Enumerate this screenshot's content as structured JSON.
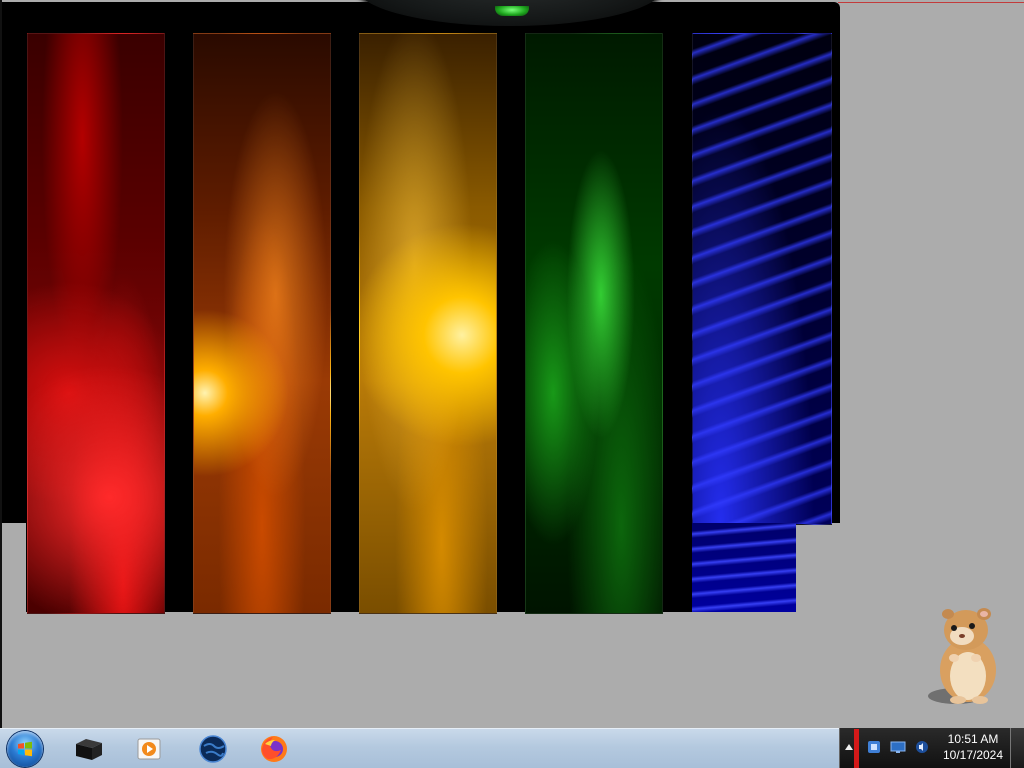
{
  "desktop": {
    "wallpaper": {
      "panels": [
        "red",
        "orange",
        "yellow",
        "green",
        "blue"
      ]
    },
    "gadget": {
      "icon": "hamster-icon"
    }
  },
  "taskbar": {
    "start": {
      "icon": "windows-flag-icon"
    },
    "pinned": [
      {
        "icon": "terminal-box-icon"
      },
      {
        "icon": "media-player-icon"
      },
      {
        "icon": "globe-icon"
      },
      {
        "icon": "firefox-icon"
      }
    ],
    "tray": {
      "icons": [
        "chevron-up-icon",
        "network-icon",
        "monitor-icon",
        "volume-icon"
      ],
      "time": "10:51 AM",
      "date": "10/17/2024"
    }
  },
  "colors": {
    "desktop_bg": "#acacac",
    "taskbar_bg": "#b4c9df",
    "tray_bg": "#111111",
    "accent_red": "#d41919"
  }
}
